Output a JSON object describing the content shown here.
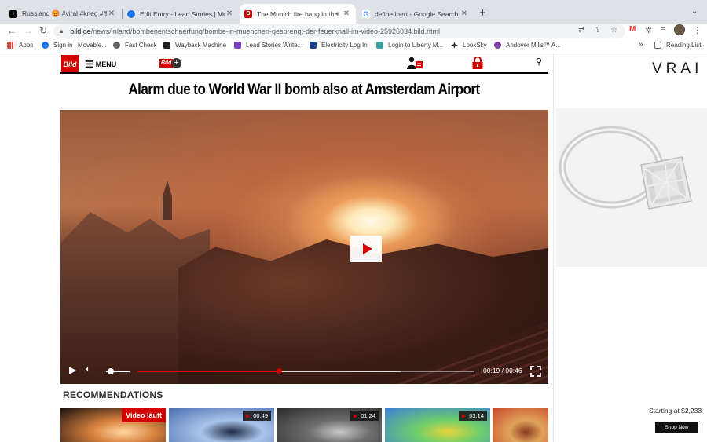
{
  "browser": {
    "tabs": [
      {
        "title": "Russland 😡 #viral #krieg #ffoc",
        "favicon": "tiktok-icon",
        "color": "#000000",
        "active": false
      },
      {
        "title": "Edit Entry - Lead Stories | Mov",
        "favicon": "movable-type-icon",
        "color": "#1a73e8",
        "active": false
      },
      {
        "title": "The Munich fire bang in th",
        "favicon": "bild-icon",
        "color": "#d40000",
        "active": true,
        "audio": true
      },
      {
        "title": "define inert - Google Search",
        "favicon": "google-icon",
        "color": "#4285f4",
        "active": false
      }
    ],
    "new_tab_label": "+",
    "url_host": "bild.de",
    "url_path": "/news/inland/bombenentschaerfung/bombe-in-muenchen-gesprengt-der-feuerknall-im-video-25926034.bild.html",
    "bookmarks": [
      {
        "label": "Apps",
        "icon": "apps-grid-icon",
        "color": "#e8710a"
      },
      {
        "label": "Sign in | Movable...",
        "icon": "movable-type-icon",
        "color": "#1a73e8"
      },
      {
        "label": "Fast Check",
        "icon": "globe-icon",
        "color": "#5f6368"
      },
      {
        "label": "Wayback Machine",
        "icon": "wayback-icon",
        "color": "#222222"
      },
      {
        "label": "Lead Stories Write...",
        "icon": "lead-stories-icon",
        "color": "#7b3fbf"
      },
      {
        "label": "Electricity Log In",
        "icon": "electricity-icon",
        "color": "#1f3f8f"
      },
      {
        "label": "Login to Liberty M...",
        "icon": "liberty-icon",
        "color": "#3aa3a3"
      },
      {
        "label": "LookSky",
        "icon": "star-icon",
        "color": "#333333"
      },
      {
        "label": "Andover Mills™ A...",
        "icon": "andover-icon",
        "color": "#7a3f9f"
      }
    ],
    "bookmarks_overflow": "»",
    "reading_list": "Reading List"
  },
  "site": {
    "logo": "Bild",
    "menu_label": "MENU",
    "bildplus_label": "Bild",
    "accent": "#d40000"
  },
  "article": {
    "headline": "Alarm due to World War II bomb also at Amsterdam Airport"
  },
  "video": {
    "current_time": "00:19",
    "duration": "00:46",
    "time_display": "00:19 / 00:46",
    "progress": 0.42,
    "buffered": 0.78,
    "volume": 0.1
  },
  "recommendations": {
    "title": "RECOMMENDATIONS",
    "items": [
      {
        "badge": "Video läuft",
        "live": true,
        "palette": [
          "#1a0f0c",
          "#d9823f",
          "#ffd7a0"
        ]
      },
      {
        "badge": "00:49",
        "live": false,
        "palette": [
          "#4a6fb0",
          "#a9c4ea",
          "#1e2b45"
        ]
      },
      {
        "badge": "01:24",
        "live": false,
        "palette": [
          "#2b2b2b",
          "#6d6d6d",
          "#c9c9c9"
        ]
      },
      {
        "badge": "03:14",
        "live": false,
        "palette": [
          "#3d7fd6",
          "#6fcf6a",
          "#e8d33c"
        ]
      },
      {
        "badge": "",
        "live": false,
        "palette": [
          "#c9452a",
          "#e0a45a",
          "#8a3a20"
        ]
      }
    ]
  },
  "ad": {
    "brand": "VRAI",
    "price_text": "Starting at $2,233",
    "cta": "Shop Now"
  }
}
